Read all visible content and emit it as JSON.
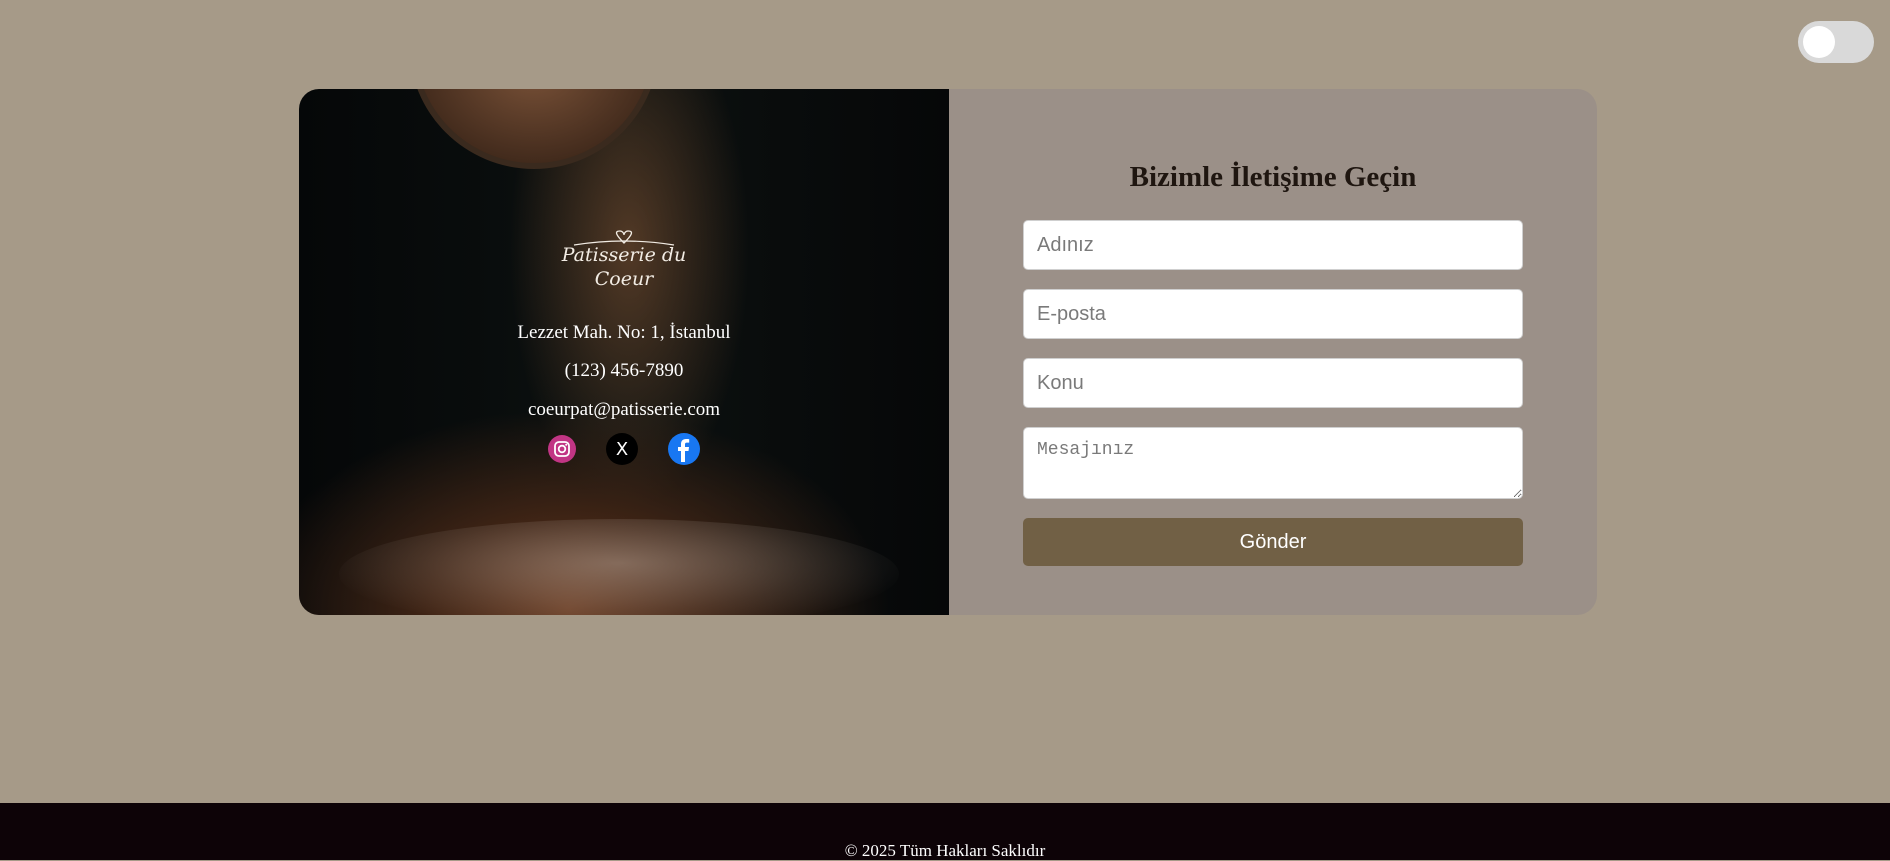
{
  "theme_toggle": {
    "state": "off"
  },
  "contact_card": {
    "brand": {
      "logo_line1": "Patisserie du",
      "logo_line2": "Coeur"
    },
    "address": "Lezzet Mah. No: 1, İstanbul",
    "phone": "(123) 456-7890",
    "email": "coeurpat@patisserie.com",
    "socials": [
      {
        "icon": "instagram-icon",
        "color": "#c13584"
      },
      {
        "icon": "x-icon",
        "glyph": "X",
        "color": "#000000"
      },
      {
        "icon": "facebook-icon",
        "color": "#1877f2"
      }
    ]
  },
  "form": {
    "title": "Bizimle İletişime Geçin",
    "name_placeholder": "Adınız",
    "email_placeholder": "E-posta",
    "subject_placeholder": "Konu",
    "message_placeholder": "Mesajınız",
    "submit_label": "Gönder"
  },
  "footer": {
    "copyright": "© 2025 Tüm Hakları Saklıdır"
  },
  "colors": {
    "background": "#a69a88",
    "form_panel": "#9b9088",
    "button": "#716045",
    "footer": "#0d0307"
  }
}
